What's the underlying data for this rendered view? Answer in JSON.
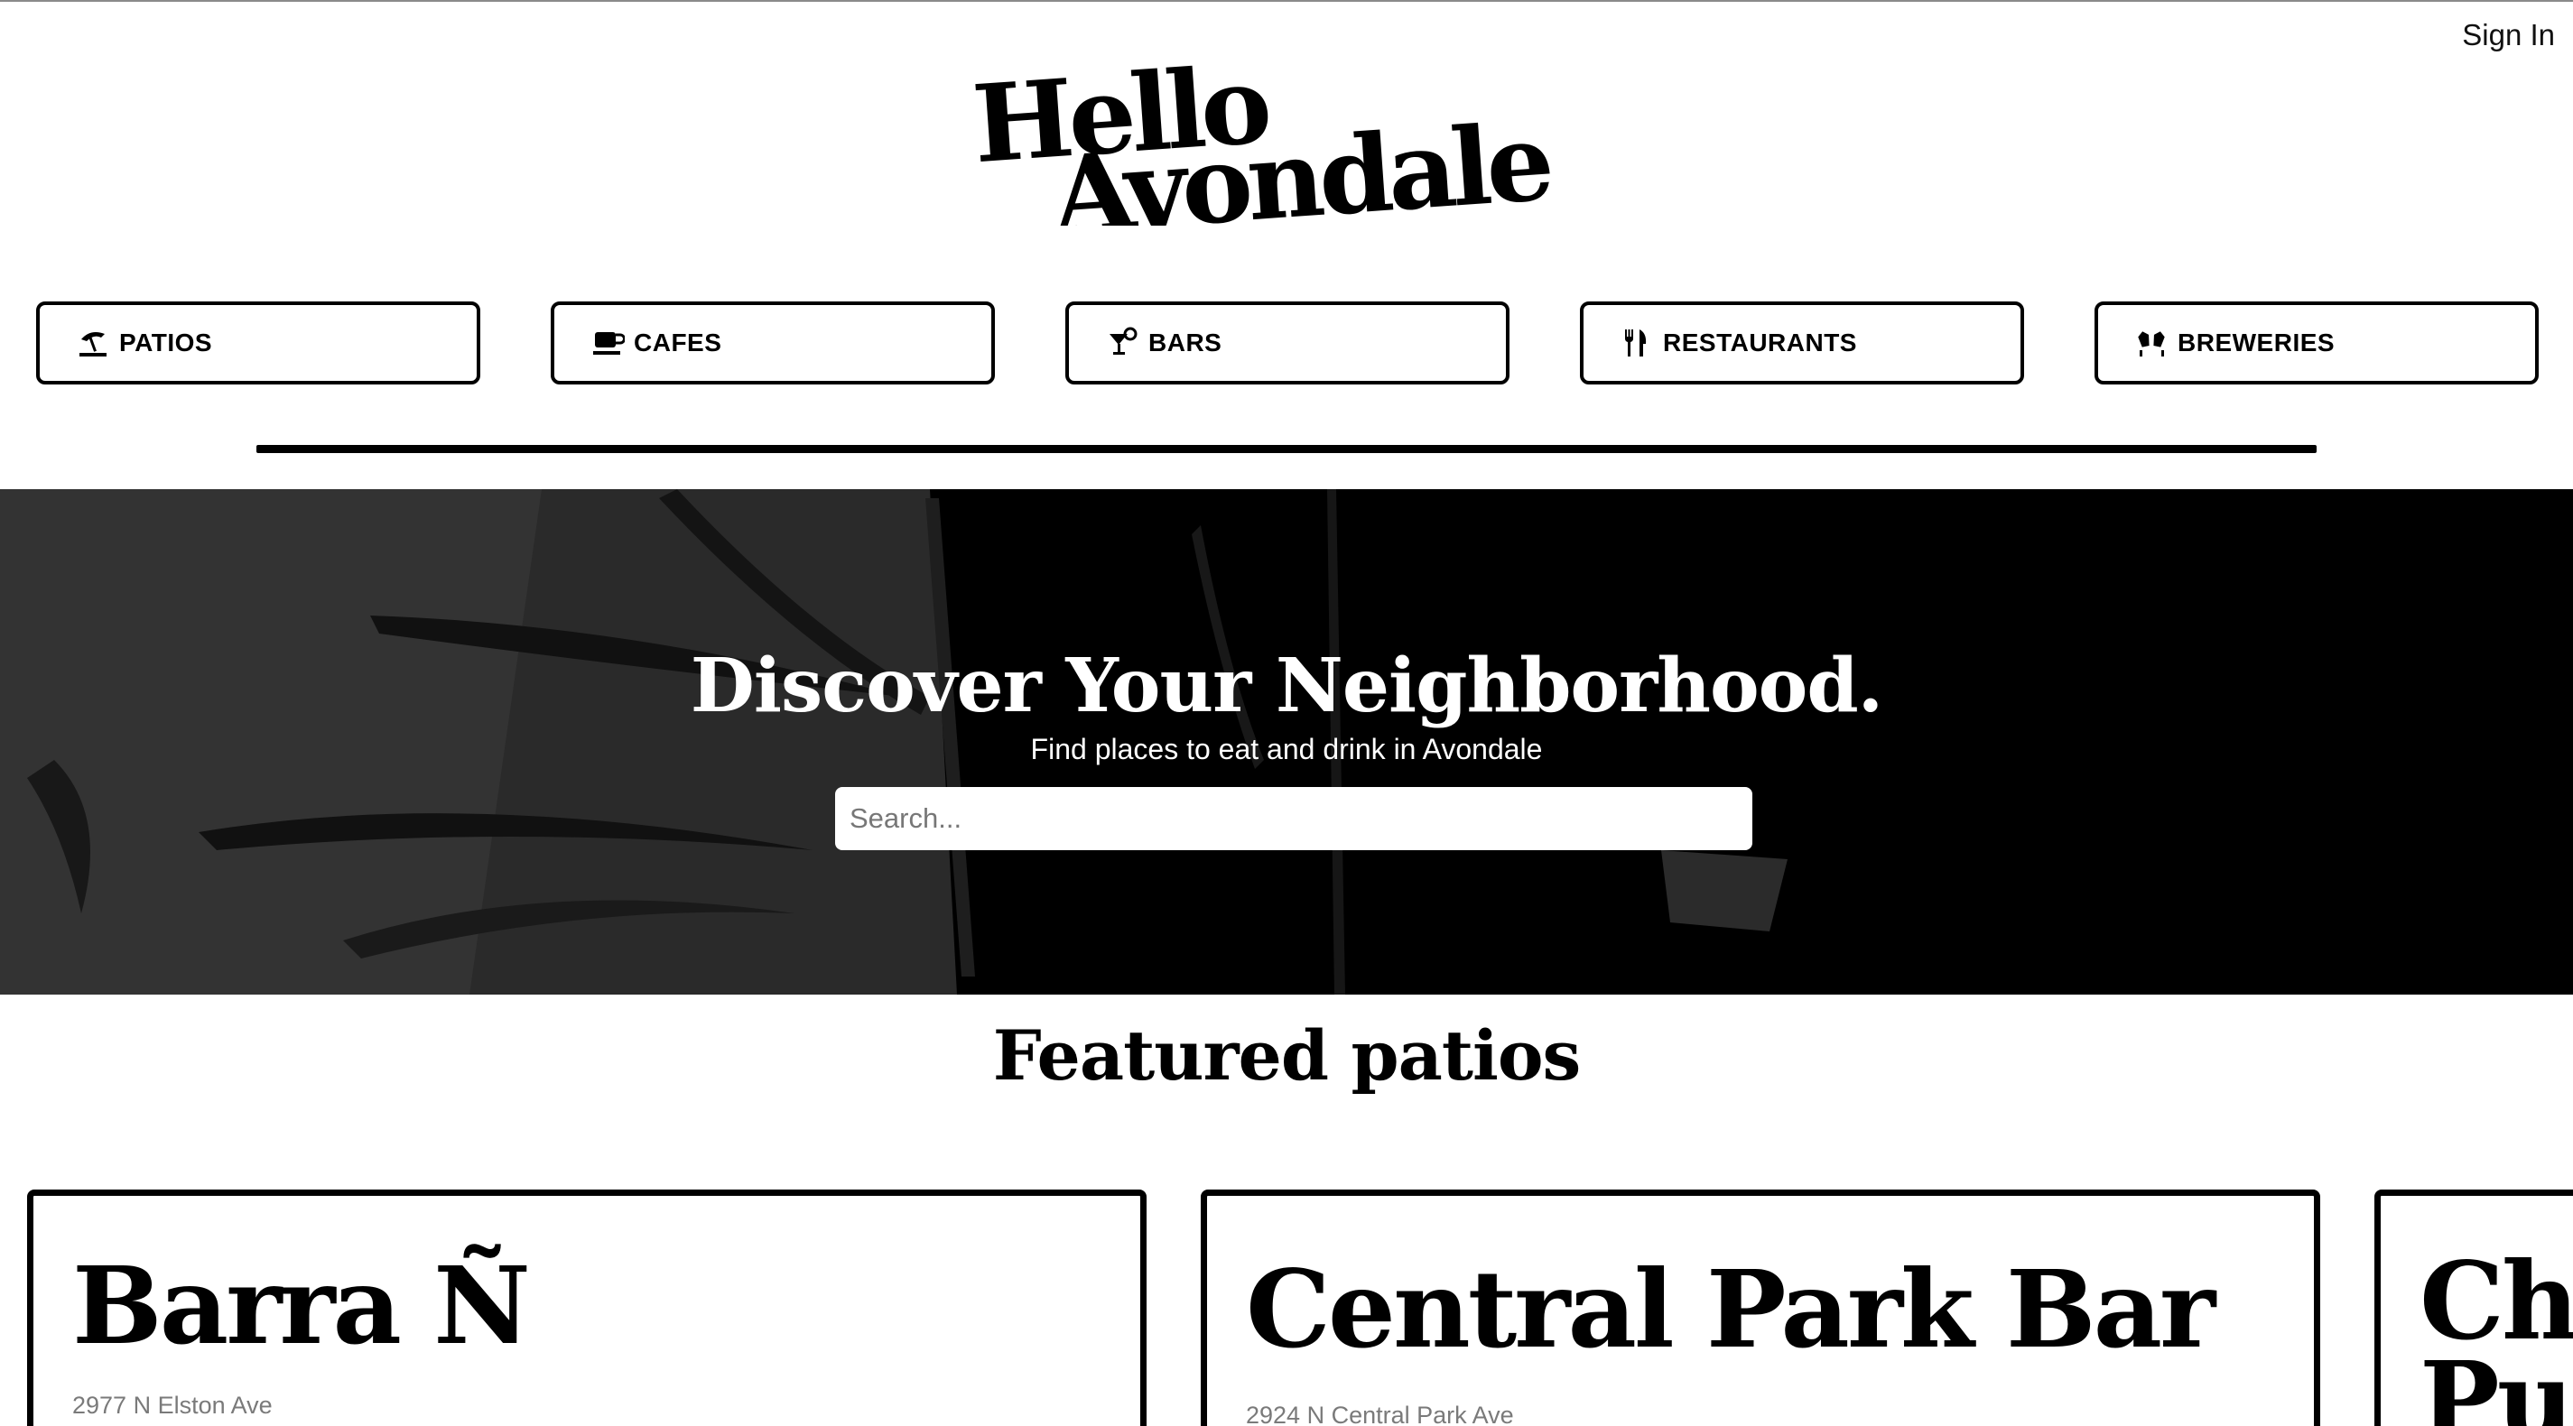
{
  "header": {
    "sign_in": "Sign In",
    "logo_line1": "Hello",
    "logo_line2": "Avondale"
  },
  "nav": [
    {
      "label": "PATIOS",
      "icon": "umbrella-beach-icon"
    },
    {
      "label": "CAFES",
      "icon": "coffee-cup-icon"
    },
    {
      "label": "BARS",
      "icon": "cocktail-icon"
    },
    {
      "label": "RESTAURANTS",
      "icon": "utensils-icon"
    },
    {
      "label": "BREWERIES",
      "icon": "beer-mugs-icon"
    }
  ],
  "hero": {
    "title": "Discover Your Neighborhood.",
    "subtitle": "Find places to eat and drink in Avondale",
    "search_placeholder": "Search..."
  },
  "featured": {
    "title": "Featured patios",
    "cards": [
      {
        "name": "Barra Ñ",
        "address": "2977 N Elston Ave"
      },
      {
        "name": "Central Park Bar",
        "address": "2924 N Central Park Ave"
      },
      {
        "name": "Ch",
        "name_line2": "Pu"
      }
    ]
  }
}
